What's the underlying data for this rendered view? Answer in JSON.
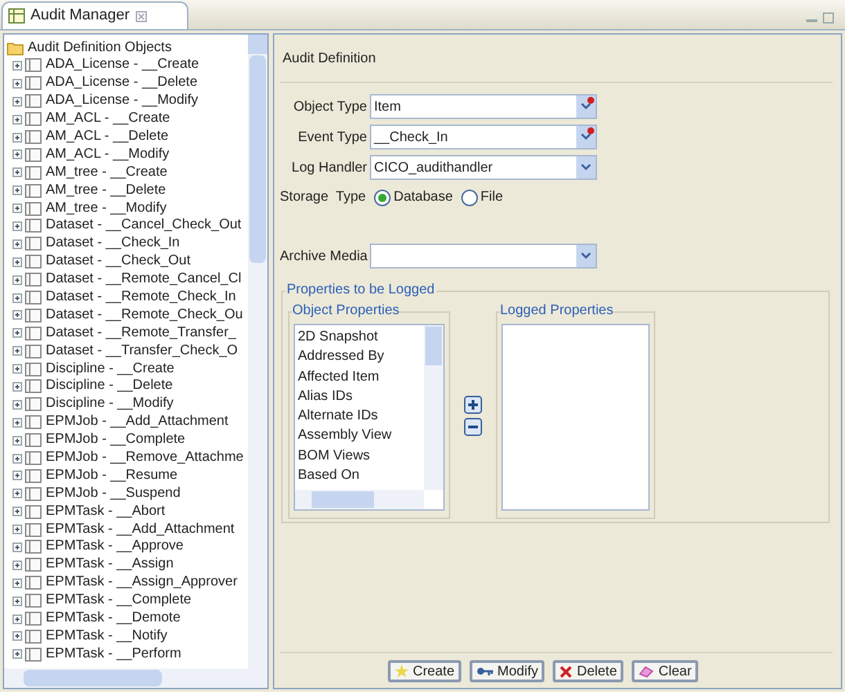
{
  "tab": {
    "title": "Audit Manager"
  },
  "tree": {
    "root": "Audit Definition Objects",
    "items": [
      "ADA_License - __Create",
      "ADA_License - __Delete",
      "ADA_License - __Modify",
      "AM_ACL - __Create",
      "AM_ACL - __Delete",
      "AM_ACL - __Modify",
      "AM_tree - __Create",
      "AM_tree - __Delete",
      "AM_tree - __Modify",
      "Dataset - __Cancel_Check_Out",
      "Dataset - __Check_In",
      "Dataset - __Check_Out",
      "Dataset - __Remote_Cancel_Cl",
      "Dataset - __Remote_Check_In",
      "Dataset - __Remote_Check_Ou",
      "Dataset - __Remote_Transfer_",
      "Dataset - __Transfer_Check_O",
      "Discipline - __Create",
      "Discipline - __Delete",
      "Discipline - __Modify",
      "EPMJob - __Add_Attachment",
      "EPMJob - __Complete",
      "EPMJob - __Remove_Attachme",
      "EPMJob - __Resume",
      "EPMJob - __Suspend",
      "EPMTask - __Abort",
      "EPMTask - __Add_Attachment",
      "EPMTask - __Approve",
      "EPMTask - __Assign",
      "EPMTask - __Assign_Approver",
      "EPMTask - __Complete",
      "EPMTask - __Demote",
      "EPMTask - __Notify",
      "EPMTask - __Perform"
    ]
  },
  "form": {
    "title": "Audit Definition",
    "fields": [
      {
        "label": "Object Type",
        "value": "Item",
        "required": true
      },
      {
        "label": "Event Type",
        "value": "__Check_In",
        "required": true
      },
      {
        "label": "Log Handler",
        "value": "CICO_audithandler",
        "required": false
      }
    ],
    "storage": {
      "label": "Storage  Type",
      "options": [
        {
          "label": "Database",
          "selected": true
        },
        {
          "label": "File",
          "selected": false
        }
      ]
    },
    "archive_media": {
      "label": "Archive Media"
    },
    "properties": {
      "title": "Properties to be Logged",
      "object_properties": {
        "title": "Object Properties",
        "items": [
          "2D Snapshot",
          "Addressed By",
          "Affected Item",
          "Alias IDs",
          "Alternate IDs",
          "Assembly View",
          "BOM Views",
          "Based On"
        ]
      },
      "logged_properties": {
        "title": "Logged Properties"
      }
    }
  },
  "buttons": [
    {
      "label": "Create",
      "kind": "create"
    },
    {
      "label": "Modify",
      "kind": "modify"
    },
    {
      "label": "Delete",
      "kind": "delete"
    },
    {
      "label": "Clear",
      "kind": "clear"
    }
  ]
}
